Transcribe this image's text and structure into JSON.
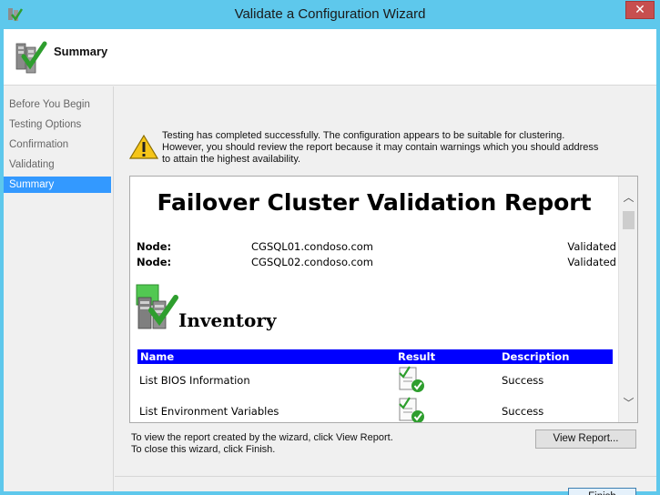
{
  "window": {
    "title": "Validate a Configuration Wizard",
    "close_glyph": "✕"
  },
  "header": {
    "title": "Summary"
  },
  "steps": [
    {
      "label": "Before You Begin",
      "active": false
    },
    {
      "label": "Testing Options",
      "active": false
    },
    {
      "label": "Confirmation",
      "active": false
    },
    {
      "label": "Validating",
      "active": false
    },
    {
      "label": "Summary",
      "active": true
    }
  ],
  "status": {
    "line1": "Testing has completed successfully. The configuration appears to be suitable for clustering.",
    "line2": "However, you should review the report because it may contain warnings which you should address",
    "line3": "to attain the highest availability."
  },
  "report": {
    "title": "Failover Cluster Validation Report",
    "nodes": [
      {
        "label": "Node:",
        "name": "CGSQL01.condoso.com",
        "status": "Validated"
      },
      {
        "label": "Node:",
        "name": "CGSQL02.condoso.com",
        "status": "Validated"
      }
    ],
    "section_title": "Inventory",
    "table_headers": {
      "name": "Name",
      "result": "Result",
      "description": "Description"
    },
    "rows": [
      {
        "name": "List BIOS Information",
        "description": "Success"
      },
      {
        "name": "List Environment Variables",
        "description": "Success"
      }
    ],
    "scroll_up_glyph": "︿",
    "scroll_down_glyph": "﹀"
  },
  "hints": {
    "view_report": "To view the report created by the wizard, click View Report.",
    "close": "To close this wizard, click Finish."
  },
  "buttons": {
    "view_report": "View Report...",
    "finish": "Finish"
  },
  "colors": {
    "title_bar": "#5ec8ec",
    "selected_step": "#3399ff",
    "table_header": "#0000ff",
    "success_check": "#2e9e2e"
  },
  "icons": {
    "app": "cluster-validate-icon",
    "header": "cluster-validate-icon",
    "warning": "warning-icon",
    "inventory": "inventory-icon",
    "result": "success-report-icon"
  }
}
